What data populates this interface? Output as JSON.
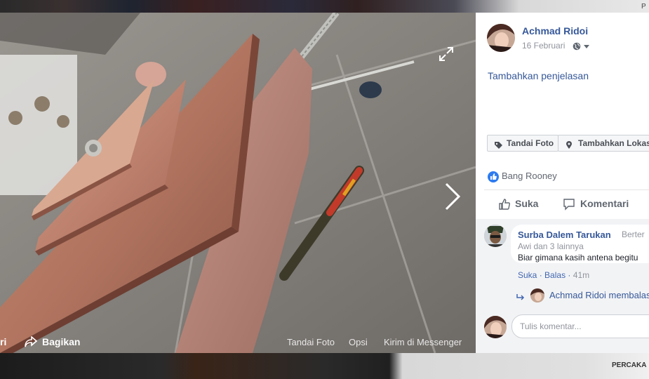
{
  "photo": {
    "share_partial": "ri",
    "share_label": "Bagikan",
    "tag_label": "Tandai Foto",
    "options_label": "Opsi",
    "messenger_label": "Kirim di Messenger"
  },
  "post": {
    "author": "Achmad Ridoi",
    "date": "16 Februari",
    "description": "Tambahkan penjelasan",
    "tag_button": "Tandai Foto",
    "location_button": "Tambahkan Lokasi"
  },
  "reactions": {
    "liker": "Bang Rooney"
  },
  "actions": {
    "like": "Suka",
    "comment": "Komentari"
  },
  "comment": {
    "author": "Surba Dalem Tarukan",
    "rank": "Berter",
    "meta": "Awi dan 3 lainnya",
    "text": "Biar gimana kasih antena begitu",
    "like_link": "Suka",
    "reply_link": "Balas",
    "time": "41m",
    "reply_preview": "Achmad Ridoi membalas"
  },
  "composer": {
    "placeholder": "Tulis komentar..."
  },
  "background": {
    "corner_text": "PERCAKA",
    "top_corner_text": "P"
  },
  "colors": {
    "link": "#365899",
    "like_blue": "#2e7bf0"
  }
}
